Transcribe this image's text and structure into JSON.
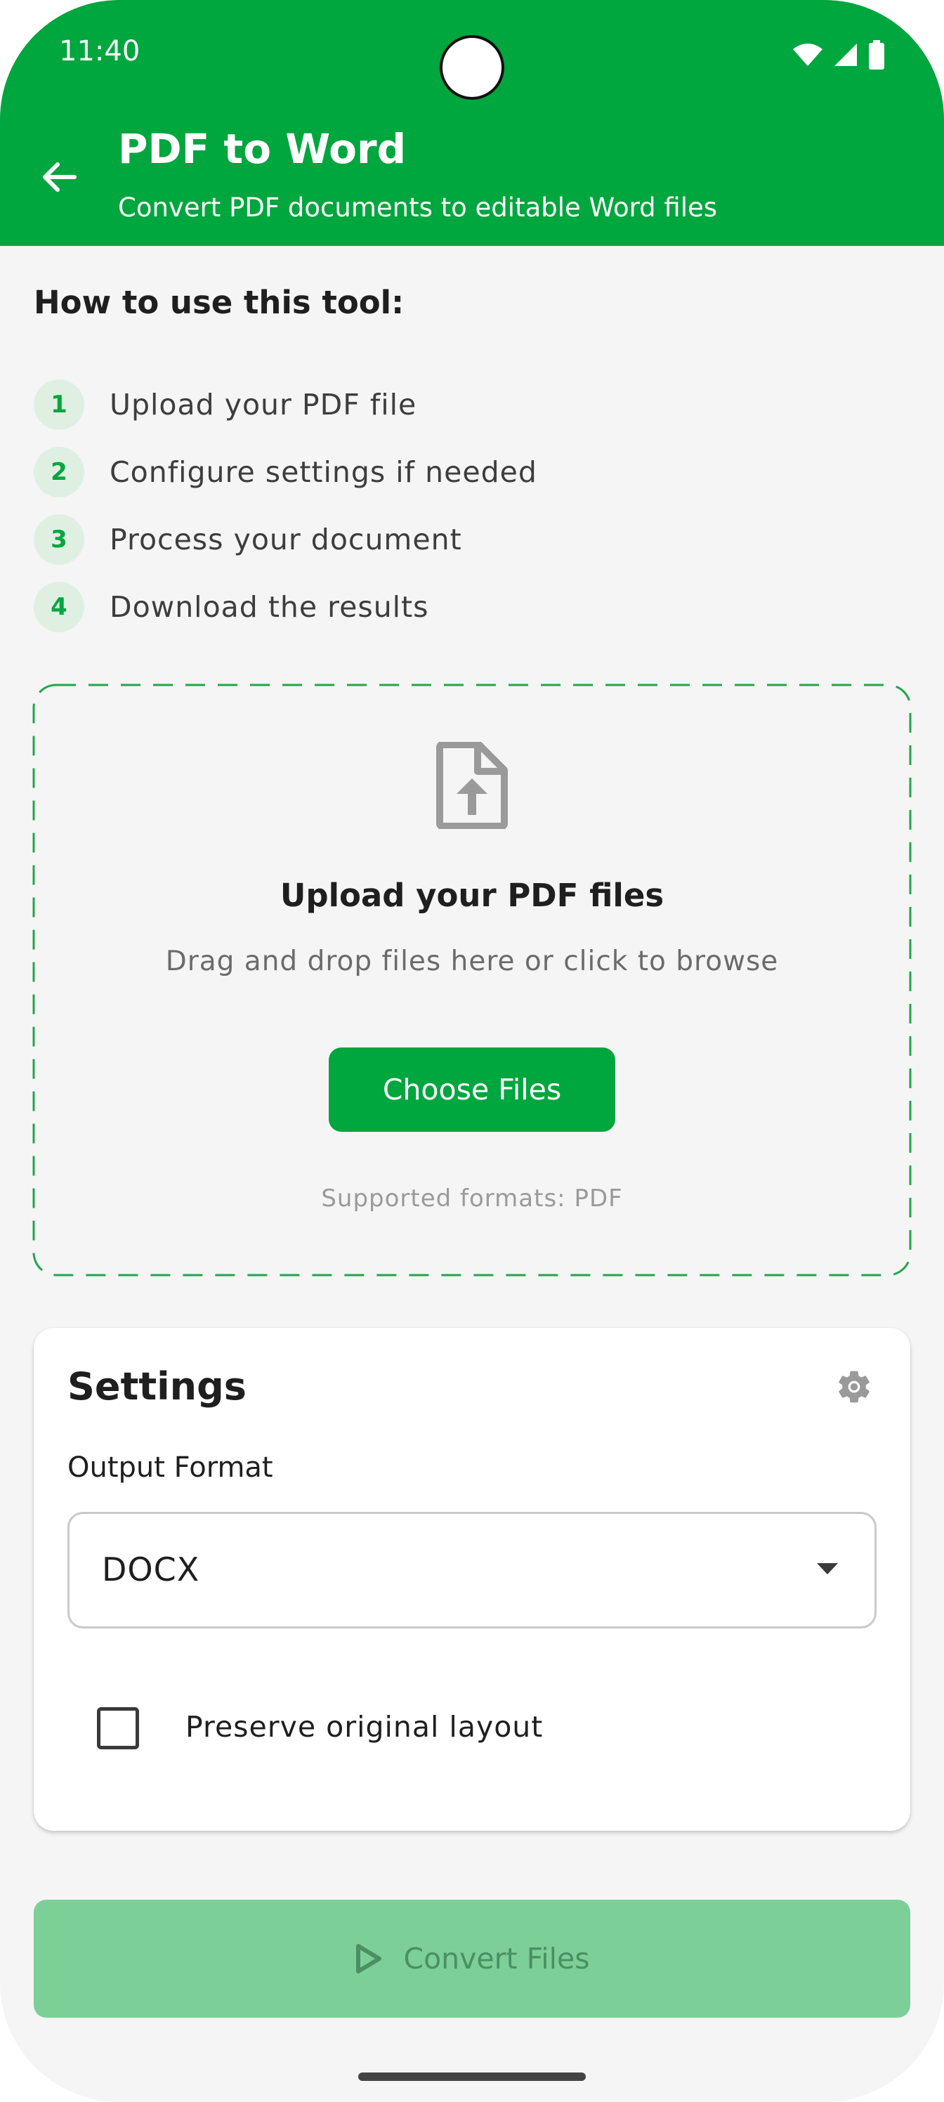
{
  "status_bar": {
    "time": "11:40",
    "icons": [
      "wifi-icon",
      "signal-icon",
      "battery-icon"
    ]
  },
  "header": {
    "back_icon": "arrow-left-icon",
    "title": "PDF to Word",
    "subtitle": "Convert PDF documents to editable Word files"
  },
  "howto": {
    "title": "How to use this tool:",
    "steps": [
      {
        "num": "1",
        "label": "Upload your PDF file"
      },
      {
        "num": "2",
        "label": "Configure settings if needed"
      },
      {
        "num": "3",
        "label": "Process your document"
      },
      {
        "num": "4",
        "label": "Download the results"
      }
    ]
  },
  "upload": {
    "icon": "file-upload-icon",
    "title": "Upload your PDF files",
    "description": "Drag and drop files here or click to browse",
    "button_label": "Choose Files",
    "formats": "Supported formats: PDF"
  },
  "settings": {
    "title": "Settings",
    "icon": "gear-icon",
    "output_format_label": "Output Format",
    "output_format_value": "DOCX",
    "preserve_layout_label": "Preserve original layout",
    "preserve_layout_checked": false
  },
  "convert": {
    "label": "Convert Files",
    "icon": "play-icon",
    "enabled": false
  },
  "colors": {
    "brand": "#00a63e",
    "brand_light": "#dff0e3",
    "disabled_button": "#7dcf98",
    "background": "#f5f5f5"
  }
}
